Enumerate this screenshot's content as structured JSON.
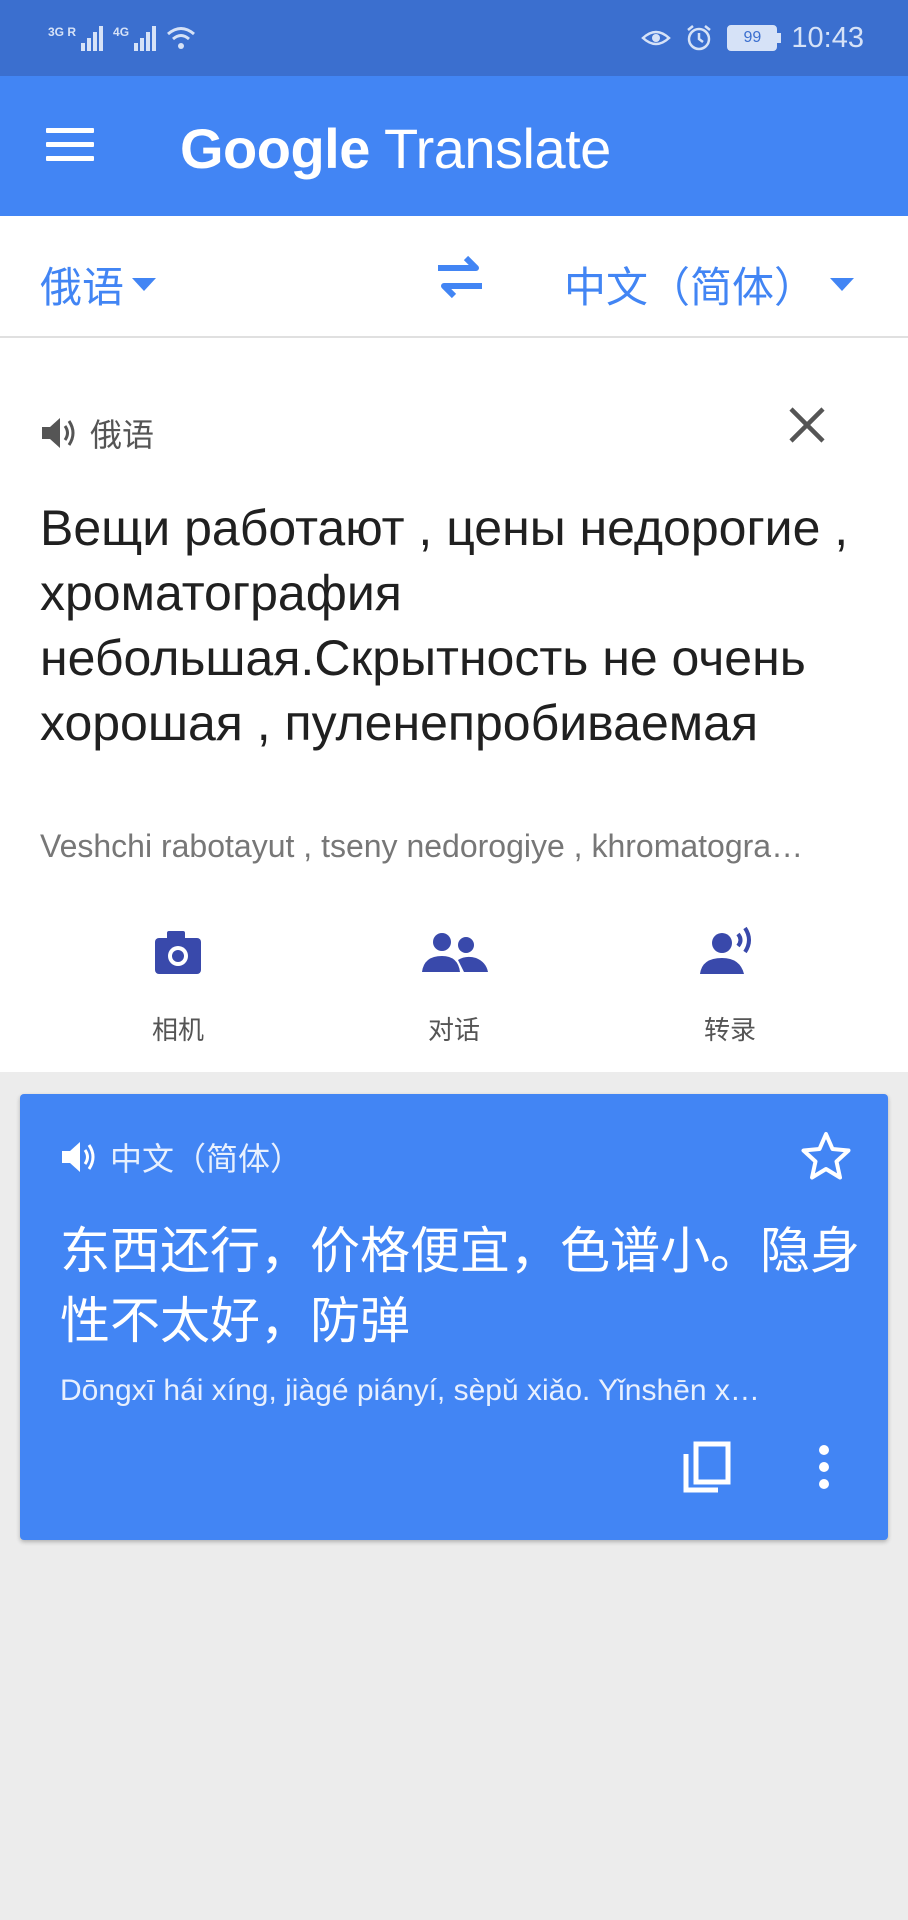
{
  "status_bar": {
    "network_1": "3G R",
    "network_2": "4G",
    "battery": "99",
    "time": "10:43"
  },
  "app_bar": {
    "title_brand": "Google",
    "title_product": "Translate",
    "menu_icon": "hamburger-menu-icon"
  },
  "language_bar": {
    "source_language": "俄语",
    "target_language": "中文（简体）",
    "swap_icon": "swap-arrows-icon"
  },
  "input": {
    "language_label": "俄语",
    "text": "Вещи работают , цены недорогие , хроматография небольшая.Скрытность не очень хорошая , пуленепробиваемая",
    "transliteration": "Veshchi rabotayut , tseny nedorogiye , khromatogra…"
  },
  "tools": [
    {
      "label": "相机",
      "icon": "camera-icon"
    },
    {
      "label": "对话",
      "icon": "people-icon"
    },
    {
      "label": "转录",
      "icon": "transcribe-icon"
    }
  ],
  "output": {
    "language_label": "中文（简体）",
    "text": "东西还行，价格便宜，色谱小。隐身性不太好，防弹",
    "pinyin": "Dōngxī hái xíng, jiàgé piányí, sèpǔ xiǎo. Yǐnshēn x…"
  },
  "colors": {
    "status_bar": "#3b6fcf",
    "primary": "#4285f4",
    "background": "#ececec"
  }
}
